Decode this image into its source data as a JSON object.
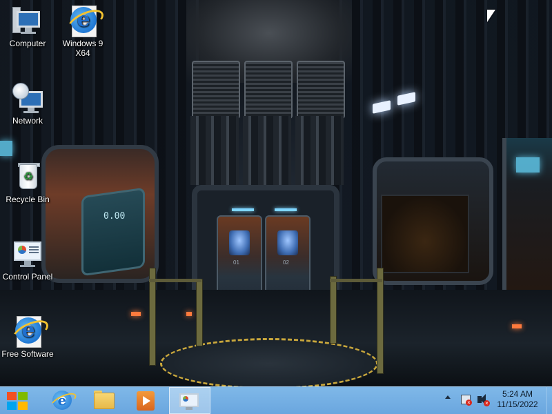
{
  "desktop": {
    "icons": [
      {
        "label": "Computer",
        "icon": "computer-icon"
      },
      {
        "label": "Windows 9\nX64",
        "icon": "internet-explorer-icon"
      },
      {
        "label": "Network",
        "icon": "network-icon"
      },
      {
        "label": "Recycle Bin",
        "icon": "recycle-bin-icon"
      },
      {
        "label": "Control Panel",
        "icon": "control-panel-icon"
      },
      {
        "label": "Free Software",
        "icon": "internet-explorer-icon"
      }
    ],
    "wallpaper": {
      "panel_readout": "0.00",
      "door_left_number": "01",
      "door_right_number": "02"
    }
  },
  "taskbar": {
    "start": {
      "icon": "windows-logo-icon"
    },
    "pinned": [
      {
        "icon": "internet-explorer-icon",
        "active": false
      },
      {
        "icon": "file-explorer-icon",
        "active": false
      },
      {
        "icon": "media-player-icon",
        "active": false
      },
      {
        "icon": "control-panel-icon",
        "active": true
      }
    ],
    "tray": {
      "icons": [
        "show-hidden-icons-icon",
        "network-disconnected-icon",
        "volume-muted-icon"
      ],
      "time": "5:24 AM",
      "date": "11/15/2022"
    },
    "color": "#6aa6df"
  }
}
